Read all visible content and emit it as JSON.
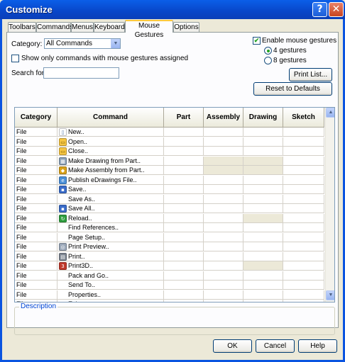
{
  "window": {
    "title": "Customize",
    "help_glyph": "?",
    "close_glyph": "✕"
  },
  "tabs": [
    {
      "label": "Toolbars",
      "active": false
    },
    {
      "label": "Commands",
      "active": false
    },
    {
      "label": "Menus",
      "active": false
    },
    {
      "label": "Keyboard",
      "active": false
    },
    {
      "label": "Mouse Gestures",
      "active": true
    },
    {
      "label": "Options",
      "active": false
    }
  ],
  "filters": {
    "category_label": "Category:",
    "category_value": "All Commands",
    "show_only_label": "Show only commands with mouse gestures assigned",
    "show_only_checked": false,
    "search_label": "Search for:",
    "search_value": ""
  },
  "gestures": {
    "enable_label": "Enable mouse gestures",
    "enable_checked": true,
    "option_4": "4 gestures",
    "option_8": "8 gestures",
    "selected": "4 gestures"
  },
  "buttons": {
    "print_list": "Print List...",
    "reset": "Reset to Defaults",
    "ok": "OK",
    "cancel": "Cancel",
    "help": "Help"
  },
  "grid": {
    "columns": [
      "Category",
      "Command",
      "Part",
      "Assembly",
      "Drawing",
      "Sketch"
    ],
    "rows": [
      {
        "category": "File",
        "command": "New..",
        "icon": "new-document-icon",
        "shaded": []
      },
      {
        "category": "File",
        "command": "Open..",
        "icon": "open-folder-icon",
        "shaded": []
      },
      {
        "category": "File",
        "command": "Close..",
        "icon": "close-folder-icon",
        "shaded": []
      },
      {
        "category": "File",
        "command": "Make Drawing from Part..",
        "icon": "make-drawing-icon",
        "shaded": [
          "assembly",
          "drawing"
        ]
      },
      {
        "category": "File",
        "command": "Make Assembly from Part..",
        "icon": "make-assembly-icon",
        "shaded": [
          "assembly",
          "drawing"
        ]
      },
      {
        "category": "File",
        "command": "Publish eDrawings File..",
        "icon": "edrawings-icon",
        "shaded": []
      },
      {
        "category": "File",
        "command": "Save..",
        "icon": "save-icon",
        "shaded": []
      },
      {
        "category": "File",
        "command": "Save As..",
        "icon": "",
        "shaded": []
      },
      {
        "category": "File",
        "command": "Save All..",
        "icon": "save-all-icon",
        "shaded": []
      },
      {
        "category": "File",
        "command": "Reload..",
        "icon": "reload-icon",
        "shaded": [
          "drawing"
        ]
      },
      {
        "category": "File",
        "command": "Find References..",
        "icon": "",
        "shaded": []
      },
      {
        "category": "File",
        "command": "Page Setup..",
        "icon": "",
        "shaded": []
      },
      {
        "category": "File",
        "command": "Print Preview..",
        "icon": "print-preview-icon",
        "shaded": []
      },
      {
        "category": "File",
        "command": "Print..",
        "icon": "print-icon",
        "shaded": []
      },
      {
        "category": "File",
        "command": "Print3D..",
        "icon": "print3d-icon",
        "shaded": [
          "drawing"
        ]
      },
      {
        "category": "File",
        "command": "Pack and Go..",
        "icon": "",
        "shaded": []
      },
      {
        "category": "File",
        "command": "Send To..",
        "icon": "",
        "shaded": []
      },
      {
        "category": "File",
        "command": "Properties..",
        "icon": "",
        "shaded": []
      },
      {
        "category": "File",
        "command": "Exit..",
        "icon": "",
        "shaded": []
      }
    ]
  },
  "description": {
    "title": "Description"
  },
  "colors": {
    "title_bar": "#0a54e0",
    "dialog_bg": "#ece9d8",
    "panel_bg": "#fcfcfe",
    "check_green": "#21a121",
    "tab_highlight": "#ffc83c",
    "link_blue": "#0046d5"
  }
}
